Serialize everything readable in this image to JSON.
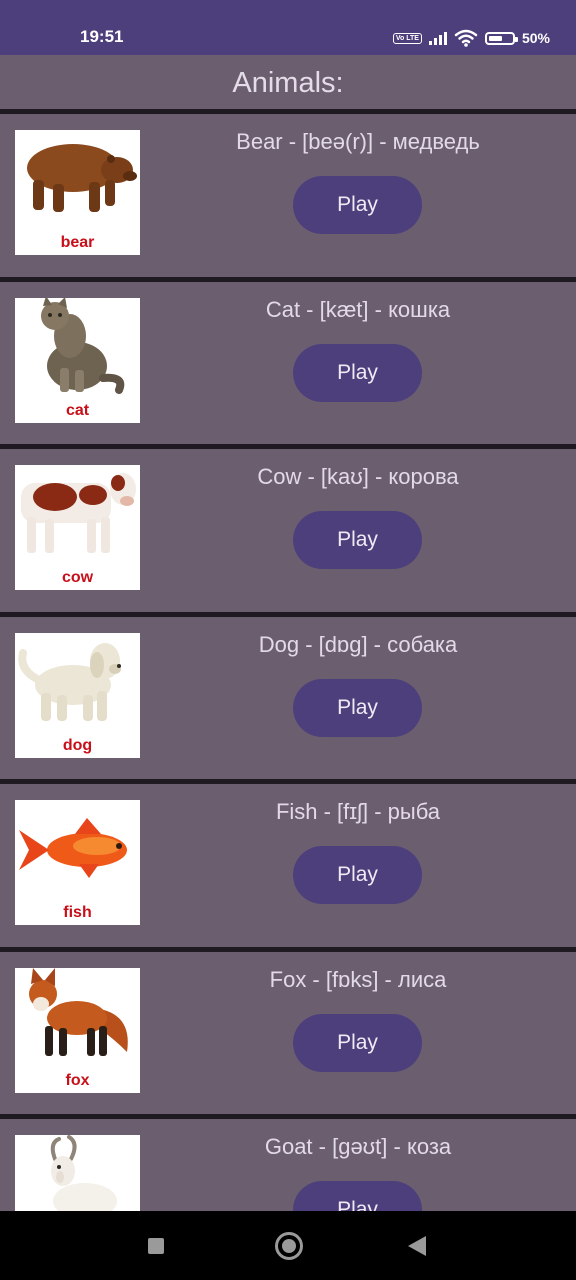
{
  "status": {
    "time": "19:51",
    "volte": "Vo LTE",
    "battery": "50%",
    "battery_level": 0.5
  },
  "header": {
    "title": "Animals:"
  },
  "items": [
    {
      "caption": "bear",
      "word": "Bear - [beə(r)] - медведь",
      "play": "Play"
    },
    {
      "caption": "cat",
      "word": "Cat - [kæt] - кошка",
      "play": "Play"
    },
    {
      "caption": "cow",
      "word": "Cow - [kaʊ] - корова",
      "play": "Play"
    },
    {
      "caption": "dog",
      "word": "Dog - [dɒg] - собака",
      "play": "Play"
    },
    {
      "caption": "fish",
      "word": "Fish - [fɪʃ] - рыба",
      "play": "Play"
    },
    {
      "caption": "fox",
      "word": "Fox - [fɒks] - лиса",
      "play": "Play"
    },
    {
      "caption": "",
      "word": "Goat - [gəʊt] - коза",
      "play": "Play"
    }
  ],
  "colors": {
    "status_bar": "#4d3f7c",
    "background": "#6b5f6f",
    "button": "#4d3f7c",
    "caption": "#c8101a"
  }
}
